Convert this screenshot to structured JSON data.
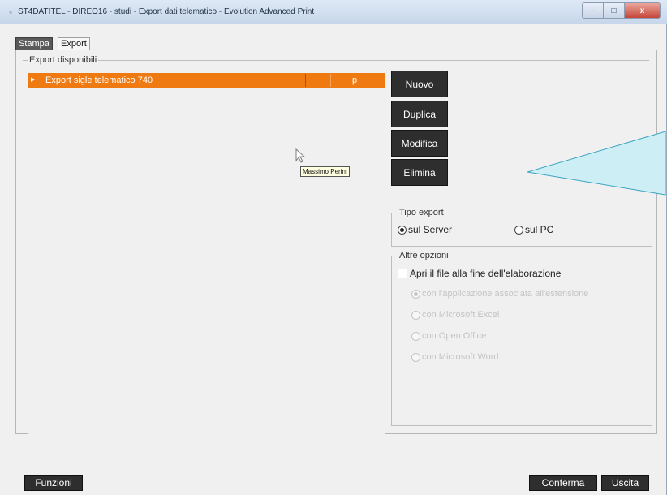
{
  "window": {
    "title": "ST4DATITEL - DIREO16 - studi - Export dati telematico - Evolution Advanced Print",
    "controls": {
      "minimize": "–",
      "maximize": "□",
      "close": "x"
    }
  },
  "tabs": [
    {
      "label": "Stampa",
      "active": true
    },
    {
      "label": "Export",
      "active": false
    }
  ],
  "export_list": {
    "legend": "Export disponibili",
    "rows": [
      {
        "name": "Export sigle telematico 740",
        "code": "p",
        "selected": true
      }
    ]
  },
  "actions": {
    "nuovo": "Nuovo",
    "duplica": "Duplica",
    "modifica": "Modifica",
    "elimina": "Elimina"
  },
  "tooltip": "Massimo Perini",
  "tipo_export": {
    "legend": "Tipo export",
    "options": [
      {
        "label": "sul Server",
        "checked": true
      },
      {
        "label": "sul PC",
        "checked": false
      }
    ]
  },
  "altre_opzioni": {
    "legend": "Altre opzioni",
    "apri_file": {
      "label": "Apri il file alla fine dell'elaborazione",
      "checked": false
    },
    "sub_options": [
      {
        "label": "con l'applicazione associata all'estensione",
        "checked": true
      },
      {
        "label": "con Microsoft Excel",
        "checked": false
      },
      {
        "label": "con Open Office",
        "checked": false
      },
      {
        "label": "con Microsoft Word",
        "checked": false
      }
    ]
  },
  "footer": {
    "funzioni": "Funzioni",
    "conferma": "Conferma",
    "uscita": "Uscita"
  },
  "colors": {
    "selection": "#f07a12",
    "button": "#2e2e2e",
    "callout": "#cdeef5"
  }
}
